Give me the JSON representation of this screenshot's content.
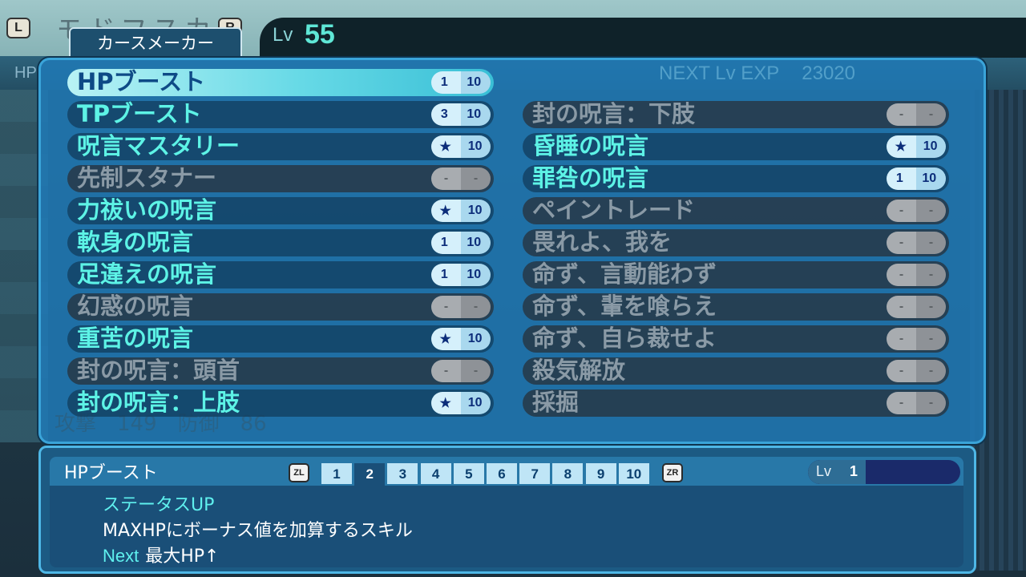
{
  "header": {
    "l_button": "L",
    "r_button": "R",
    "character_name": "モドフスカ",
    "class_tab": "カースメーカー",
    "level_label": "Lv",
    "level_value": "55",
    "hp_ghost": "HP",
    "next_exp_label": "NEXT Lv EXP",
    "next_exp_value": "23020"
  },
  "skills_left": [
    {
      "name": "HPブースト",
      "level": "1",
      "max": "10",
      "state": "selected"
    },
    {
      "name": "TPブースト",
      "level": "3",
      "max": "10",
      "state": "learned"
    },
    {
      "name": "呪言マスタリー",
      "level": "★",
      "max": "10",
      "state": "learned"
    },
    {
      "name": "先制スタナー",
      "level": "-",
      "max": "-",
      "state": "locked"
    },
    {
      "name": "力祓いの呪言",
      "level": "★",
      "max": "10",
      "state": "learned"
    },
    {
      "name": "軟身の呪言",
      "level": "1",
      "max": "10",
      "state": "learned"
    },
    {
      "name": "足違えの呪言",
      "level": "1",
      "max": "10",
      "state": "learned"
    },
    {
      "name": "幻惑の呪言",
      "level": "-",
      "max": "-",
      "state": "locked"
    },
    {
      "name": "重苦の呪言",
      "level": "★",
      "max": "10",
      "state": "learned"
    },
    {
      "name": "封の呪言：頭首",
      "level": "-",
      "max": "-",
      "state": "locked"
    },
    {
      "name": "封の呪言：上肢",
      "level": "★",
      "max": "10",
      "state": "learned"
    }
  ],
  "skills_right": [
    {
      "name": "封の呪言：下肢",
      "level": "-",
      "max": "-",
      "state": "locked"
    },
    {
      "name": "昏睡の呪言",
      "level": "★",
      "max": "10",
      "state": "learned"
    },
    {
      "name": "罪咎の呪言",
      "level": "1",
      "max": "10",
      "state": "learned"
    },
    {
      "name": "ペイントレード",
      "level": "-",
      "max": "-",
      "state": "locked"
    },
    {
      "name": "畏れよ、我を",
      "level": "-",
      "max": "-",
      "state": "locked"
    },
    {
      "name": "命ず、言動能わず",
      "level": "-",
      "max": "-",
      "state": "locked"
    },
    {
      "name": "命ず、輩を喰らえ",
      "level": "-",
      "max": "-",
      "state": "locked"
    },
    {
      "name": "命ず、自ら裁せよ",
      "level": "-",
      "max": "-",
      "state": "locked"
    },
    {
      "name": "殺気解放",
      "level": "-",
      "max": "-",
      "state": "locked"
    },
    {
      "name": "採掘",
      "level": "-",
      "max": "-",
      "state": "locked"
    }
  ],
  "detail": {
    "title": "HPブースト",
    "zl_button": "ZL",
    "zr_button": "ZR",
    "level_tabs": [
      "1",
      "2",
      "3",
      "4",
      "5",
      "6",
      "7",
      "8",
      "9",
      "10"
    ],
    "active_tab": "2",
    "lv_label": "Lv",
    "lv_value": "1",
    "category": "ステータスUP",
    "description": "MAXHPにボーナス値を加算するスキル",
    "next_label": "Next",
    "next_text": "最大HP↑"
  },
  "background_ghost": {
    "atk_text": "攻撃　149　防御　86"
  },
  "colors": {
    "panel": "#2079b6",
    "skill_name": "#5df3e6",
    "skill_name_locked": "#8a9aa6",
    "accent": "#5fe7d6"
  }
}
